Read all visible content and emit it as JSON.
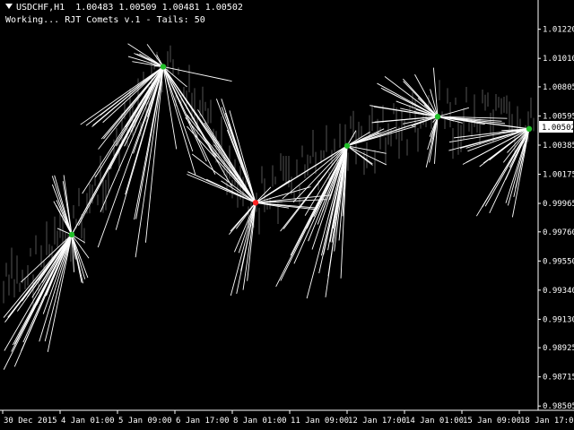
{
  "header": {
    "symbol": "USDCHF,H1",
    "ohlc": "1.00483 1.00509 1.00481 1.00502",
    "status": "Working... RJT Comets v.1 - Tails: 50"
  },
  "colors": {
    "background": "#000000",
    "axis": "#ffffff",
    "tail": "#ffffff",
    "candle": "#555555",
    "node_up": "#22c02a",
    "node_down": "#ff2222",
    "price_box_bg": "#ffffff",
    "price_box_text": "#000000"
  },
  "chart_data": {
    "type": "line",
    "title": "",
    "xlabel": "",
    "ylabel": "",
    "ylim": [
      0.985,
      1.0125
    ],
    "grid": false,
    "y_ticks": [
      1.0122,
      1.0101,
      1.00805,
      1.00595,
      1.00385,
      1.00175,
      0.99965,
      0.9976,
      0.9955,
      0.9934,
      0.9913,
      0.98925,
      0.98715,
      0.98505
    ],
    "x_ticks": [
      "30 Dec 2015",
      "4 Jan 01:00",
      "5 Jan 09:00",
      "6 Jan 17:00",
      "8 Jan 01:00",
      "11 Jan 09:00",
      "12 Jan 17:00",
      "14 Jan 01:00",
      "15 Jan 09:00",
      "18 Jan 17:00"
    ],
    "current_price": "1.00502",
    "nodes": [
      {
        "time": "4 Jan 03:00",
        "price": 0.9974,
        "color": "up"
      },
      {
        "time": "6 Jan 02:00",
        "price": 1.0095,
        "color": "up"
      },
      {
        "time": "8 Jan 00:00",
        "price": 0.9997,
        "color": "down"
      },
      {
        "time": "12 Jan 16:00",
        "price": 1.0038,
        "color": "up"
      },
      {
        "time": "14 Jan 00:00",
        "price": 1.0059,
        "color": "up"
      },
      {
        "time": "18 Jan 17:00",
        "price": 1.00502,
        "color": "up"
      }
    ],
    "series": [
      {
        "values": [
          0.9974,
          1.0095,
          0.9997,
          1.0038,
          1.0059,
          1.00502
        ]
      }
    ]
  }
}
